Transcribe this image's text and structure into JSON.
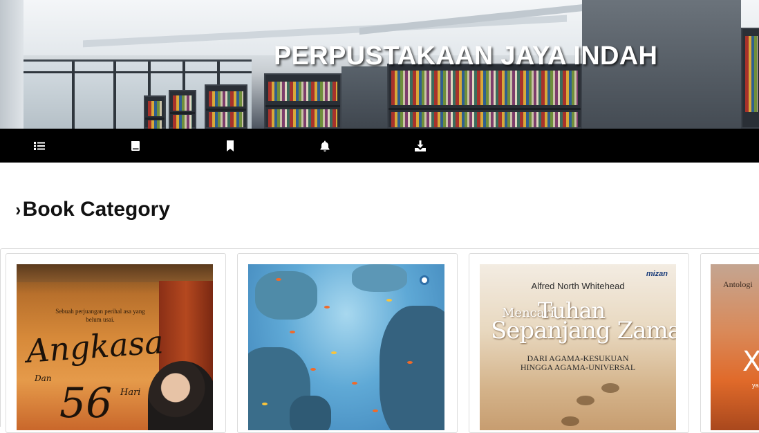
{
  "header": {
    "title": "PERPUSTAKAAN JAYA INDAH"
  },
  "nav": {
    "items": [
      {
        "icon": "list-icon"
      },
      {
        "icon": "book-icon"
      },
      {
        "icon": "bookmark-icon"
      },
      {
        "icon": "bell-icon"
      },
      {
        "icon": "download-icon"
      }
    ]
  },
  "section": {
    "chevron": "›",
    "title": "Book Category"
  },
  "books": [
    {
      "tagline": "Sebuah perjuangan perihal asa yang belum usai.",
      "title_line1": "Angkasa",
      "title_and": "Dan",
      "title_num": "56",
      "title_days": "Hari"
    },
    {
      "publisher_badge": ""
    },
    {
      "publisher": "mizan",
      "author": "Alfred North Whitehead",
      "title_small": "Mencari",
      "title_big": "Tuhan",
      "title_line2": "Sepanjang Zaman",
      "subtitle_1": "DARI AGAMA-KESUKUAN",
      "subtitle_2": "HINGGA AGAMA-UNIVERSAL"
    },
    {
      "label": "Antologi",
      "mark": "X",
      "tiny": "yan"
    }
  ],
  "colors": {
    "navbar": "#000000",
    "nav_icon": "#ffffff",
    "heading": "#111111",
    "card_border": "#dcdcdc"
  }
}
